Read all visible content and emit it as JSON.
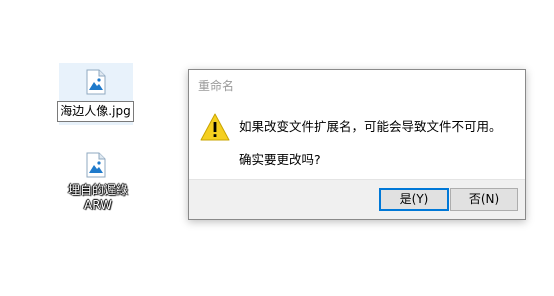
{
  "desktop": {
    "files": [
      {
        "name": "海边人像.jpg",
        "selected": true,
        "icon": "image-file-icon"
      },
      {
        "name": "埋自的遲綠\nARW",
        "selected": false,
        "icon": "image-file-icon"
      }
    ]
  },
  "dialog": {
    "title": "重命名",
    "icon": "warning-icon",
    "message": "如果改变文件扩展名，可能会导致文件不可用。",
    "question": "确实要更改吗?",
    "buttons": {
      "yes": "是(Y)",
      "no": "否(N)"
    }
  },
  "colors": {
    "accent": "#0078d7",
    "warning": "#f5cf1f",
    "selection": "#e8f2fb"
  }
}
